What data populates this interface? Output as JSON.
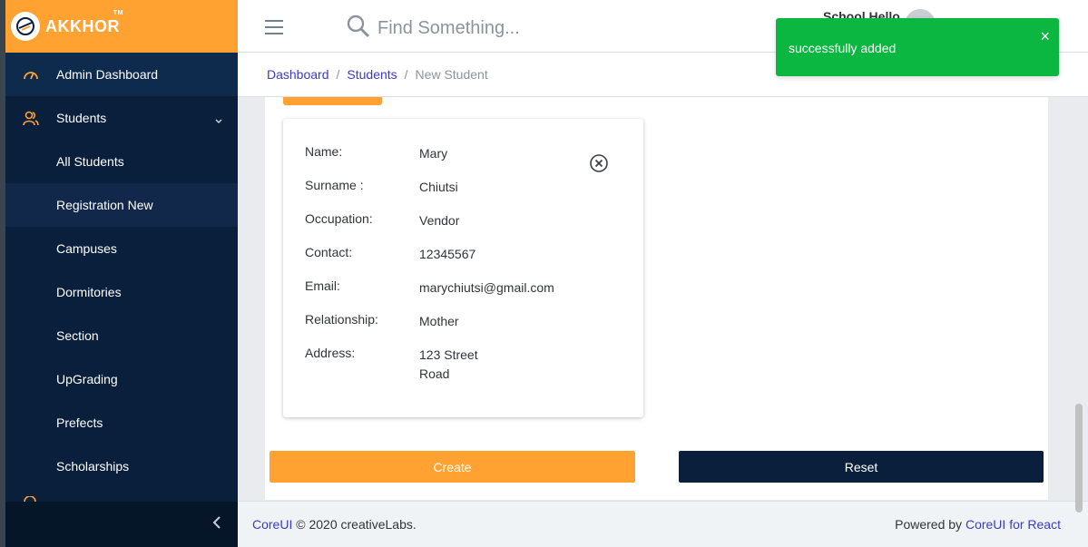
{
  "brand": {
    "name": "AKKHOR",
    "tm": "TM"
  },
  "sidebar": {
    "items": [
      {
        "label": "Admin Dashboard",
        "icon": "speedometer-icon"
      },
      {
        "label": "Students",
        "icon": "users-icon"
      }
    ],
    "sub_items": [
      {
        "label": "All Students"
      },
      {
        "label": "Registration New"
      },
      {
        "label": "Campuses"
      },
      {
        "label": "Dormitories"
      },
      {
        "label": "Section"
      },
      {
        "label": "UpGrading"
      },
      {
        "label": "Prefects"
      },
      {
        "label": "Scholarships"
      }
    ]
  },
  "header": {
    "search_placeholder": "Find Something...",
    "user_name": "School Hello"
  },
  "breadcrumb": {
    "items": [
      "Dashboard",
      "Students"
    ],
    "current": "New Student"
  },
  "guardian": {
    "rows": [
      {
        "label": "Name:",
        "value": "Mary"
      },
      {
        "label": "Surname :",
        "value": "Chiutsi"
      },
      {
        "label": "Occupation:",
        "value": "Vendor"
      },
      {
        "label": "Contact:",
        "value": "12345567"
      },
      {
        "label": "Email:",
        "value": "marychiutsi@gmail.com"
      },
      {
        "label": "Relationship:",
        "value": "Mother"
      },
      {
        "label": "Address:",
        "value": "123 Street",
        "value2": "Road"
      }
    ]
  },
  "buttons": {
    "create": "Create",
    "reset": "Reset"
  },
  "footer": {
    "left_link": "CoreUI",
    "left_text": "© 2020 creativeLabs.",
    "right_text": "Powered by",
    "right_link": "CoreUI for React"
  },
  "toast": {
    "message": "successfully added",
    "close": "×"
  },
  "colors": {
    "accent": "#ffa231",
    "sidebar": "#0a1f3b",
    "success": "#0bb741",
    "link": "#3b3bc4"
  }
}
